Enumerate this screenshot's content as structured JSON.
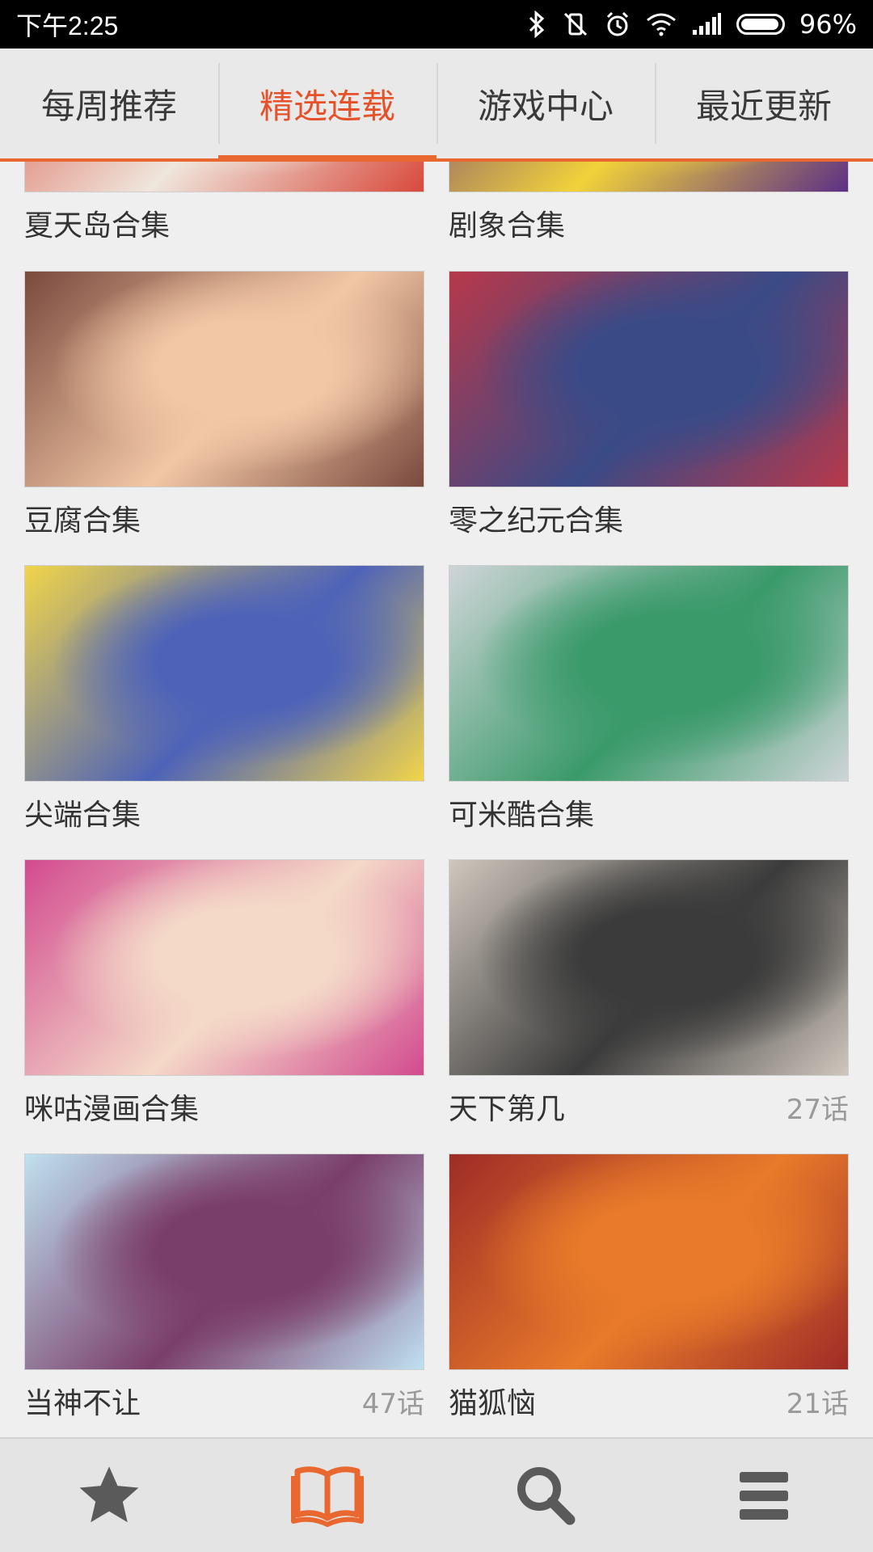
{
  "status_bar": {
    "time": "下午2:25",
    "battery": "96%",
    "battery_level": 0.96,
    "icons": [
      "bluetooth-icon",
      "mute-vibrate-icon",
      "alarm-icon",
      "wifi-icon",
      "signal-icon",
      "battery-icon"
    ]
  },
  "tabs": [
    {
      "label": "每周推荐",
      "active": false
    },
    {
      "label": "精选连载",
      "active": true
    },
    {
      "label": "游戏中心",
      "active": false
    },
    {
      "label": "最近更新",
      "active": false
    }
  ],
  "grid": [
    {
      "title": "夏天岛合集",
      "count": "",
      "art": [
        "#d8493b",
        "#efe6dc"
      ]
    },
    {
      "title": "剧象合集",
      "count": "",
      "art": [
        "#5c2f86",
        "#f2d23a"
      ]
    },
    {
      "title": "豆腐合集",
      "count": "",
      "art": [
        "#7a4a3e",
        "#f2c7a5"
      ]
    },
    {
      "title": "零之纪元合集",
      "count": "",
      "art": [
        "#b8384a",
        "#3a4a86"
      ]
    },
    {
      "title": "尖端合集",
      "count": "",
      "art": [
        "#f1d54a",
        "#4e63b8"
      ]
    },
    {
      "title": "可米酷合集",
      "count": "",
      "art": [
        "#cfd5d8",
        "#3a9a6a"
      ]
    },
    {
      "title": "咪咕漫画合集",
      "count": "",
      "art": [
        "#d24b8f",
        "#f4d9c8"
      ]
    },
    {
      "title": "天下第几",
      "count": "27话",
      "art": [
        "#cfc7bd",
        "#3b3b3b"
      ]
    },
    {
      "title": "当神不让",
      "count": "47话",
      "art": [
        "#bfe1f0",
        "#7a3e6a"
      ]
    },
    {
      "title": "猫狐恼",
      "count": "21话",
      "art": [
        "#9e2c27",
        "#e87a2a"
      ]
    }
  ],
  "bottom_nav": [
    {
      "icon": "star-icon",
      "active": false
    },
    {
      "icon": "book-icon",
      "active": true
    },
    {
      "icon": "search-icon",
      "active": false
    },
    {
      "icon": "menu-icon",
      "active": false
    }
  ],
  "colors": {
    "accent": "#e8682f",
    "active_tab_text": "#e5522a",
    "nav_icon": "#5a5a5a"
  }
}
